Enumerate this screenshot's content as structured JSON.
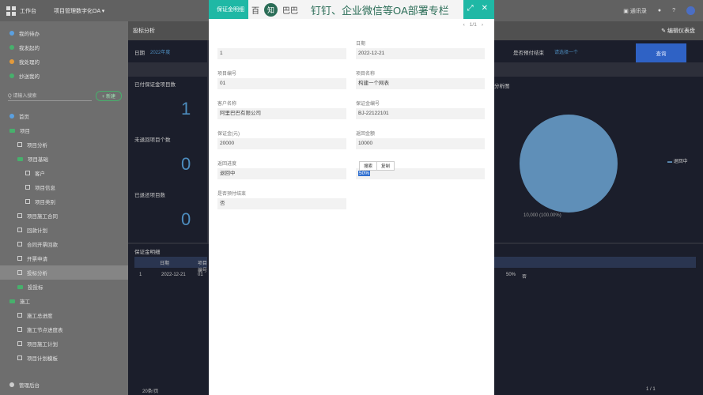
{
  "topbar": {
    "workbench": "工作台",
    "project_tab": "项目管理数字化OA",
    "right": {
      "contacts": "通讯录"
    }
  },
  "sidebar": {
    "items_top": [
      "我的待办",
      "我发起的",
      "我处理的",
      "抄送我的"
    ],
    "search_placeholder": "Q 请输入搜索",
    "new_label": "+ 新建",
    "tree": [
      {
        "label": "首页",
        "level": 0,
        "icon": "home-icon"
      },
      {
        "label": "项目",
        "level": 0,
        "icon": "folder-icon"
      },
      {
        "label": "项目分析",
        "level": 1,
        "icon": "page-icon"
      },
      {
        "label": "项目基础",
        "level": 1,
        "icon": "folder-icon"
      },
      {
        "label": "客户",
        "level": 2,
        "icon": "page-icon"
      },
      {
        "label": "项目信息",
        "level": 2,
        "icon": "page-icon"
      },
      {
        "label": "项目类别",
        "level": 2,
        "icon": "page-icon"
      },
      {
        "label": "项目施工合同",
        "level": 1,
        "icon": "page-icon"
      },
      {
        "label": "回款计划",
        "level": 1,
        "icon": "page-icon"
      },
      {
        "label": "合同开票回款",
        "level": 1,
        "icon": "page-icon"
      },
      {
        "label": "开票申请",
        "level": 1,
        "icon": "page-icon"
      },
      {
        "label": "投标分析",
        "level": 1,
        "icon": "page-icon"
      },
      {
        "label": "投投标",
        "level": 1,
        "icon": "folder-icon"
      },
      {
        "label": "施工",
        "level": 0,
        "icon": "folder-icon"
      },
      {
        "label": "施工总进度",
        "level": 1,
        "icon": "page-icon"
      },
      {
        "label": "施工节点进度表",
        "level": 1,
        "icon": "page-icon"
      },
      {
        "label": "项目施工计划",
        "level": 1,
        "icon": "page-icon"
      },
      {
        "label": "项目计划模板",
        "level": 1,
        "icon": "page-icon"
      }
    ],
    "footer": "管理后台"
  },
  "dashboard": {
    "title": "投标分析",
    "refresh": "编辑仪表盘",
    "filter_date_label": "日期",
    "filter_date_value": "2022年度",
    "filter_status_label": "是否预付结束",
    "filter_status_value": "请选择一个",
    "query_button": "查询",
    "cards": [
      {
        "title": "已付保证金项目数",
        "value": "1"
      },
      {
        "title": "未退回项目个数",
        "value": "0"
      },
      {
        "title": "已退还项目数",
        "value": "0"
      }
    ],
    "pie": {
      "title": "分析图",
      "legend": "退回中",
      "label": "10,000 (100.00%)",
      "value_share": 1.0
    },
    "table": {
      "title": "保证金明细",
      "headers": [
        "日期",
        "项目编号"
      ],
      "row": {
        "index": "1",
        "date": "2022-12-21",
        "code": "01",
        "percent": "50%",
        "status": "否"
      },
      "pager_left": "20条/页",
      "pager_right": "1 / 1"
    }
  },
  "modal": {
    "title": "保证金明细",
    "banner": {
      "left": "百",
      "zhi": "知",
      "mid": "巴巴",
      "slogan": "钉钉、企业微信等OA部署专栏"
    },
    "pager": "1/1",
    "fields_left": [
      {
        "label": "",
        "value": "1"
      },
      {
        "label": "项目编号",
        "value": "01"
      },
      {
        "label": "客户名称",
        "value": "阿里巴巴有限公司"
      },
      {
        "label": "保证金(元)",
        "value": "20000"
      },
      {
        "label": "返回进度",
        "value": "退回中"
      },
      {
        "label": "是否预付结束",
        "value": "否"
      }
    ],
    "fields_right": [
      {
        "label": "日期",
        "value": "2022-12-21"
      },
      {
        "label": "项目名称",
        "value": "构建一个网表"
      },
      {
        "label": "保证金编号",
        "value": "BJ-22122101"
      },
      {
        "label": "返回金额",
        "value": "10000"
      },
      {
        "label": "",
        "value": "50%"
      }
    ],
    "popup": [
      "搜索",
      "复制"
    ]
  }
}
